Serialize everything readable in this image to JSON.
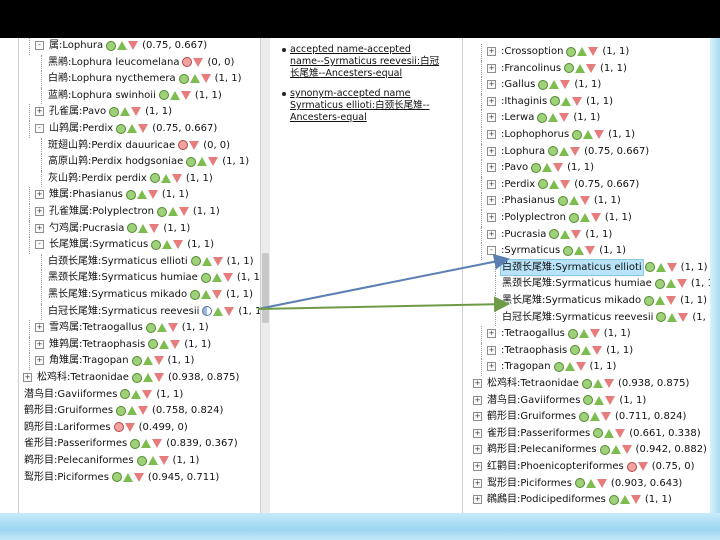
{
  "left_tree": {
    "rows": [
      {
        "label": "属:Lophura",
        "depth": 1,
        "expander": "-",
        "marks": "cud",
        "score": "(0.75, 0.667)"
      },
      {
        "label": "黑鹇:Lophura leucomelana",
        "depth": 2,
        "expander": "",
        "marks": "rd",
        "score": "(0, 0)"
      },
      {
        "label": "白鹇:Lophura nycthemera",
        "depth": 2,
        "expander": "",
        "marks": "cud",
        "score": "(1, 1)"
      },
      {
        "label": "蓝鹇:Lophura swinhoii",
        "depth": 2,
        "expander": "",
        "marks": "cud",
        "score": "(1, 1)"
      },
      {
        "label": "孔雀属:Pavo",
        "depth": 1,
        "expander": "+",
        "marks": "cud",
        "score": "(1, 1)"
      },
      {
        "label": "山鹑属:Perdix",
        "depth": 1,
        "expander": "-",
        "marks": "cud",
        "score": "(0.75, 0.667)"
      },
      {
        "label": "斑翅山鹑:Perdix dauuricae",
        "depth": 2,
        "expander": "",
        "marks": "rd",
        "score": "(0, 0)"
      },
      {
        "label": "高原山鹑:Perdix hodgsoniae",
        "depth": 2,
        "expander": "",
        "marks": "cud",
        "score": "(1, 1)"
      },
      {
        "label": "灰山鹑:Perdix perdix",
        "depth": 2,
        "expander": "",
        "marks": "cud",
        "score": "(1, 1)"
      },
      {
        "label": "雉属:Phasianus",
        "depth": 1,
        "expander": "+",
        "marks": "cud",
        "score": "(1, 1)"
      },
      {
        "label": "孔雀雉属:Polyplectron",
        "depth": 1,
        "expander": "+",
        "marks": "cud",
        "score": "(1, 1)"
      },
      {
        "label": "勺鸡属:Pucrasia",
        "depth": 1,
        "expander": "+",
        "marks": "cud",
        "score": "(1, 1)"
      },
      {
        "label": "长尾雉属:Syrmaticus",
        "depth": 1,
        "expander": "-",
        "marks": "cud",
        "score": "(1, 1)"
      },
      {
        "label": "白颈长尾雉:Syrmaticus ellioti",
        "depth": 2,
        "expander": "",
        "marks": "cud",
        "score": "(1, 1)"
      },
      {
        "label": "黑颈长尾雉:Syrmaticus humiae",
        "depth": 2,
        "expander": "",
        "marks": "cud",
        "score": "(1, 1)"
      },
      {
        "label": "黑长尾雉:Syrmaticus mikado",
        "depth": 2,
        "expander": "",
        "marks": "cud",
        "score": "(1, 1)"
      },
      {
        "label": "白冠长尾雉:Syrmaticus reevesii",
        "depth": 2,
        "expander": "",
        "marks": "hud",
        "score": "(1, 1)"
      },
      {
        "label": "雪鸡属:Tetraogallus",
        "depth": 1,
        "expander": "+",
        "marks": "cud",
        "score": "(1, 1)"
      },
      {
        "label": "雉鹑属:Tetraophasis",
        "depth": 1,
        "expander": "+",
        "marks": "cud",
        "score": "(1, 1)"
      },
      {
        "label": "角雉属:Tragopan",
        "depth": 1,
        "expander": "+",
        "marks": "cud",
        "score": "(1, 1)"
      },
      {
        "label": "松鸡科:Tetraonidae",
        "depth": 0,
        "expander": "+",
        "marks": "cud",
        "score": "(0.938, 0.875)"
      },
      {
        "label": "潜鸟目:Gaviiformes",
        "depth": 0,
        "expander": "",
        "marks": "cud",
        "score": "(1, 1)"
      },
      {
        "label": "鹤形目:Gruiformes",
        "depth": 0,
        "expander": "",
        "marks": "cud",
        "score": "(0.758, 0.824)"
      },
      {
        "label": "鸥形目:Lariformes",
        "depth": 0,
        "expander": "",
        "marks": "rd",
        "score": "(0.499, 0)"
      },
      {
        "label": "雀形目:Passeriformes",
        "depth": 0,
        "expander": "",
        "marks": "cud",
        "score": "(0.839, 0.367)"
      },
      {
        "label": "鹈形目:Pelecaniformes",
        "depth": 0,
        "expander": "",
        "marks": "cud",
        "score": "(1, 1)"
      },
      {
        "label": "䴕形目:Piciformes",
        "depth": 0,
        "expander": "",
        "marks": "cud",
        "score": "(0.945, 0.711)"
      }
    ]
  },
  "notes": {
    "items": [
      "accepted name-accepted name--Syrmaticus reevesii:白冠长尾雉--Ancesters-equal",
      "synonym-accepted name Syrmaticus ellioti:白颈长尾雉--Ancesters-equal"
    ]
  },
  "right_tree": {
    "rows": [
      {
        "label": ":Crossoption",
        "depth": 1,
        "expander": "+",
        "marks": "cud",
        "score": "(1, 1)"
      },
      {
        "label": ":Francolinus",
        "depth": 1,
        "expander": "+",
        "marks": "cud",
        "score": "(1, 1)"
      },
      {
        "label": ":Gallus",
        "depth": 1,
        "expander": "+",
        "marks": "cud",
        "score": "(1, 1)"
      },
      {
        "label": ":Ithaginis",
        "depth": 1,
        "expander": "+",
        "marks": "cud",
        "score": "(1, 1)"
      },
      {
        "label": ":Lerwa",
        "depth": 1,
        "expander": "+",
        "marks": "cud",
        "score": "(1, 1)"
      },
      {
        "label": ":Lophophorus",
        "depth": 1,
        "expander": "+",
        "marks": "cud",
        "score": "(1, 1)"
      },
      {
        "label": ":Lophura",
        "depth": 1,
        "expander": "+",
        "marks": "cud",
        "score": "(0.75, 0.667)"
      },
      {
        "label": ":Pavo",
        "depth": 1,
        "expander": "+",
        "marks": "cud",
        "score": "(1, 1)"
      },
      {
        "label": ":Perdix",
        "depth": 1,
        "expander": "+",
        "marks": "cud",
        "score": "(0.75, 0.667)"
      },
      {
        "label": ":Phasianus",
        "depth": 1,
        "expander": "+",
        "marks": "cud",
        "score": "(1, 1)"
      },
      {
        "label": ":Polyplectron",
        "depth": 1,
        "expander": "+",
        "marks": "cud",
        "score": "(1, 1)"
      },
      {
        "label": ":Pucrasia",
        "depth": 1,
        "expander": "+",
        "marks": "cud",
        "score": "(1, 1)"
      },
      {
        "label": ":Syrmaticus",
        "depth": 1,
        "expander": "-",
        "marks": "cud",
        "score": "(1, 1)"
      },
      {
        "label": "白颈长尾雉:Syrmaticus ellioti",
        "depth": 2,
        "expander": "",
        "marks": "cud",
        "score": "(1, 1)",
        "selected": true
      },
      {
        "label": "黑颈长尾雉:Syrmaticus humiae",
        "depth": 2,
        "expander": "",
        "marks": "cud",
        "score": "(1, 1)"
      },
      {
        "label": "黑长尾雉:Syrmaticus mikado",
        "depth": 2,
        "expander": "",
        "marks": "cud",
        "score": "(1, 1)"
      },
      {
        "label": "白冠长尾雉:Syrmaticus reevesii",
        "depth": 2,
        "expander": "",
        "marks": "cud",
        "score": "(1, 1)"
      },
      {
        "label": ":Tetraogallus",
        "depth": 1,
        "expander": "+",
        "marks": "cud",
        "score": "(1, 1)"
      },
      {
        "label": ":Tetraophasis",
        "depth": 1,
        "expander": "+",
        "marks": "cud",
        "score": "(1, 1)"
      },
      {
        "label": ":Tragopan",
        "depth": 1,
        "expander": "+",
        "marks": "cud",
        "score": "(1, 1)"
      },
      {
        "label": "松鸡科:Tetraonidae",
        "depth": 0,
        "expander": "+",
        "marks": "cud",
        "score": "(0.938, 0.875)"
      },
      {
        "label": "潜鸟目:Gaviiformes",
        "depth": 0,
        "expander": "+",
        "marks": "cud",
        "score": "(1, 1)"
      },
      {
        "label": "鹤形目:Gruiformes",
        "depth": 0,
        "expander": "+",
        "marks": "cud",
        "score": "(0.711, 0.824)"
      },
      {
        "label": "雀形目:Passeriformes",
        "depth": 0,
        "expander": "+",
        "marks": "cud",
        "score": "(0.661, 0.338)"
      },
      {
        "label": "鹈形目:Pelecaniformes",
        "depth": 0,
        "expander": "+",
        "marks": "cud",
        "score": "(0.942, 0.882)"
      },
      {
        "label": "红鹳目:Phoenicopteriformes",
        "depth": 0,
        "expander": "+",
        "marks": "rd",
        "score": "(0.75, 0)"
      },
      {
        "label": "䴕形目:Piciformes",
        "depth": 0,
        "expander": "+",
        "marks": "cud",
        "score": "(0.903, 0.643)"
      },
      {
        "label": "鸊鷉目:Podicipediformes",
        "depth": 0,
        "expander": "+",
        "marks": "cud",
        "score": "(1, 1)"
      }
    ]
  },
  "colors": {
    "arrow": "#5b7fb3",
    "arrow_green": "#6f9a46",
    "selection": "#b9e3f8"
  }
}
